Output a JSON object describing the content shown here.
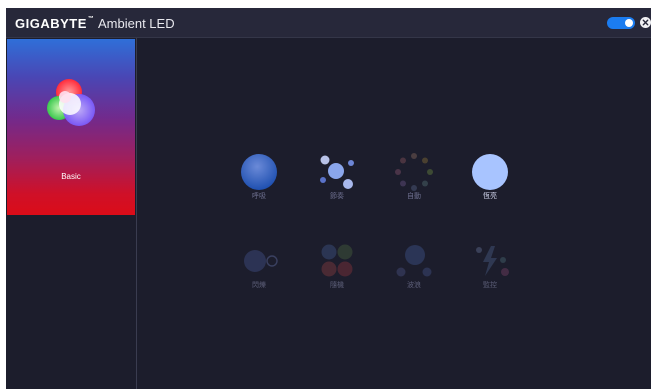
{
  "titlebar": {
    "brand": "GIGABYTE",
    "brand_tm": "™",
    "app_title": "Ambient LED"
  },
  "sidebar": {
    "mode": {
      "label": "Basic"
    }
  },
  "effects": [
    {
      "label": "呼吸",
      "icon": "breathing-icon"
    },
    {
      "label": "節奏",
      "icon": "beat-icon"
    },
    {
      "label": "自動",
      "icon": "auto-cycle-icon"
    },
    {
      "label": "恆亮",
      "icon": "static-icon",
      "selected": true
    },
    {
      "label": "閃爍",
      "icon": "flash-icon"
    },
    {
      "label": "隨機",
      "icon": "random-icon"
    },
    {
      "label": "波浪",
      "icon": "wave-icon"
    },
    {
      "label": "監控",
      "icon": "monitor-icon"
    }
  ],
  "colors": {
    "accent": "#1b7cf0",
    "background": "#1c1d2c",
    "titlebar": "#27283a"
  }
}
